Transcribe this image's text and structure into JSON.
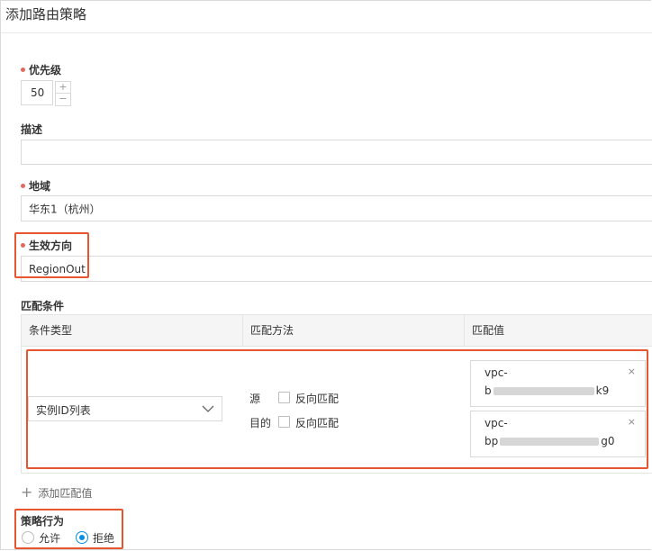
{
  "dialog": {
    "title": "添加路由策略"
  },
  "priority": {
    "label": "优先级",
    "value": "50",
    "increment": "+",
    "decrement": "−"
  },
  "description": {
    "label": "描述",
    "value": ""
  },
  "region": {
    "label": "地域",
    "value": "华东1（杭州）"
  },
  "direction": {
    "label": "生效方向",
    "value": "RegionOut"
  },
  "match": {
    "label": "匹配条件",
    "columns": [
      "条件类型",
      "匹配方法",
      "匹配值"
    ],
    "condition_type": "实例ID列表",
    "source_label": "源",
    "dest_label": "目的",
    "reverse_label": "反向匹配",
    "values": [
      {
        "line1": "vpc-",
        "prefix": "b",
        "suffix": "k9",
        "close": "×"
      },
      {
        "line1": "vpc-",
        "prefix": "bp",
        "suffix": "g0",
        "close": "×"
      }
    ],
    "add_label": "添加匹配值",
    "add_icon": "+"
  },
  "action": {
    "label": "策略行为",
    "options": [
      "允许",
      "拒绝"
    ],
    "selected": "拒绝"
  },
  "colors": {
    "highlight": "#e8562f",
    "required": "#e06a5d",
    "accent": "#0a8de4"
  }
}
